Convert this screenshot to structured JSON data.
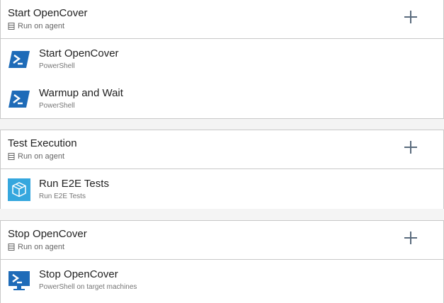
{
  "phases": [
    {
      "title": "Start OpenCover",
      "subtitle": "Run on agent",
      "tasks": [
        {
          "name": "Start OpenCover",
          "type": "PowerShell",
          "icon": "powershell-icon"
        },
        {
          "name": "Warmup and Wait",
          "type": "PowerShell",
          "icon": "powershell-icon"
        }
      ]
    },
    {
      "title": "Test Execution",
      "subtitle": "Run on agent",
      "tasks": [
        {
          "name": "Run E2E Tests",
          "type": "Run E2E Tests",
          "icon": "package-cube-icon"
        }
      ]
    },
    {
      "title": "Stop OpenCover",
      "subtitle": "Run on agent",
      "tasks": [
        {
          "name": "Stop OpenCover",
          "type": "PowerShell on target machines",
          "icon": "powershell-monitor-icon"
        }
      ]
    }
  ],
  "colors": {
    "powershell_blue": "#1e6bb8",
    "cube_bg": "#35a7de",
    "border": "#c8c8c8",
    "separator_bg": "#f4f4f4"
  }
}
